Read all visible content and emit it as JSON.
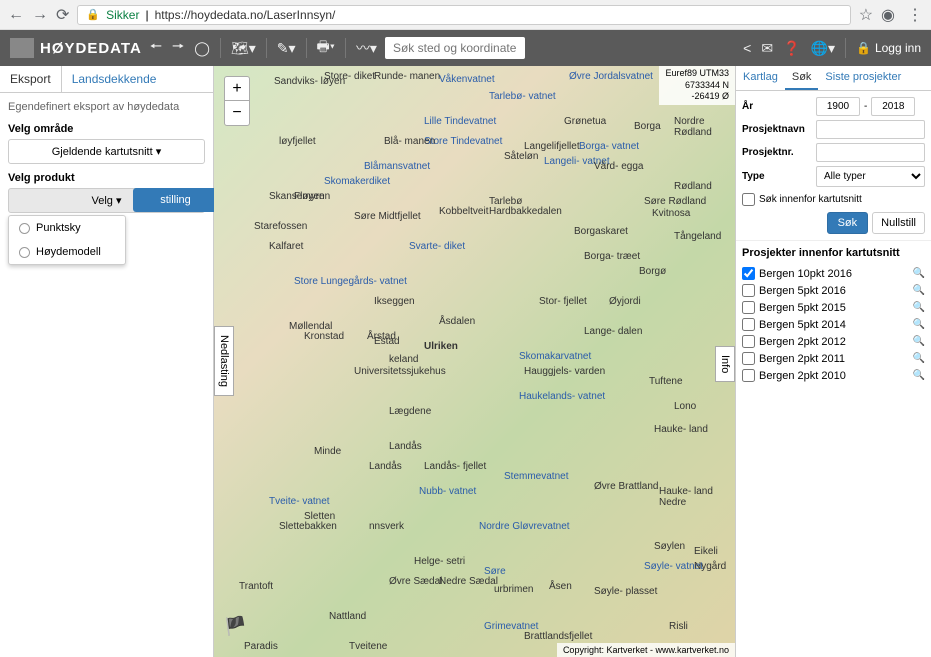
{
  "browser": {
    "secure_label": "Sikker",
    "url": "https://hoydedata.no/LaserInnsyn/"
  },
  "header": {
    "brand": "HØYDEDATA",
    "search_placeholder": "Søk sted og koordinater",
    "login": "Logg inn"
  },
  "left": {
    "tabs": {
      "eksport": "Eksport",
      "lands": "Landsdekkende"
    },
    "desc": "Egendefinert eksport av høydedata",
    "velg_omrade": "Velg område",
    "gjeldende": "Gjeldende kartutsnitt",
    "velg_produkt": "Velg produkt",
    "velg": "Velg",
    "punktsky": "Punktsky",
    "hoydemodell": "Høydemodell",
    "bestilling": "stilling"
  },
  "map": {
    "zoom_in": "+",
    "zoom_out": "−",
    "nedlasting": "Nedlasting",
    "info": "Info",
    "coord_sys": "Euref89 UTM33",
    "coord_n": "6733344 N",
    "coord_e": "-26419 Ø",
    "credit": "Copyright: Kartverket - www.kartverket.no",
    "labels": {
      "loyfjellet": "løyfjellet",
      "ulriken": "Ulriken",
      "storfjellet": "Stor-\nfjellet",
      "vardegga": "Vård-\negga",
      "borga": "Borga",
      "nordre_rodland": "Nordre\nRødland",
      "rodland": "Rødland",
      "tangeland": "Tångeland",
      "borgo": "Borgø",
      "langedalen": "Lange-\ndalen",
      "lono": "Lono",
      "haukeland": "Hauke-\nland",
      "ovre_brattland": "Øvre\nBrattland",
      "haukeland_nedre": "Hauke-\nland\nNedre",
      "eikeli": "Eikeli",
      "soylen": "Søylen",
      "nattland": "Nattland",
      "paradis": "Paradis",
      "minde": "Minde",
      "kronstad": "Kronstad",
      "landas": "Landås",
      "gronetua": "Grønetua",
      "sandviksloyen": "Sandviks-\nløyen",
      "rundemanen": "Runde-\nmanen",
      "blamanen": "Blå-\nmanen",
      "sore_midtfjellet": "Søre\nMidtfjellet",
      "svartediket": "Svarte-\ndiket",
      "universitetssjukehus": "Universitetssjukehus",
      "haugjelsvarden": "Hauggjels-\nvarden",
      "skomakarvatnet": "Skomakarvatnet",
      "haukelandsvatnet": "Haukelands-\nvatnet",
      "landasfjellet": "Landås-\nfjellet",
      "stemmevatnet": "Stemmevatnet",
      "nordre_glovrevatnet": "Nordre\nGløvrevatnet",
      "grimevatnet": "Grimevatnet",
      "nedre_saedal": "Nedre\nSædal",
      "ovre_saedal": "Øvre\nSædal",
      "brattlandsfjellet": "Brattlandsfjellet",
      "risli": "Risli",
      "soylevatnet": "Søyle-\nvatnet",
      "soyleplasset": "Søyle-\nplasset",
      "asen": "Åsen",
      "asdalen": "Åsdalen",
      "laegdene": "Lægdene",
      "tarlebo": "Tarlebø",
      "tarlebovatnet": "Tarlebø-\nvatnet",
      "blamansvatnet": "Blåmansvatnet",
      "vakenvatnet": "Våkenvatnet",
      "lille_tindevatnet": "Lille\nTindevatnet",
      "store_tindevatnet": "Store\nTindevatnet",
      "langelifjellet": "Langelifjellet",
      "borgavatnet": "Borga-\nvatnet",
      "langelivatnet": "Langeli-\nvatnet",
      "sore_rodland": "Søre Rødland",
      "kvitnosa": "Kvitnosa",
      "skomakerdiket": "Skomakerdiket",
      "storediket": "Store-\ndiket",
      "store_lungegards": "Store\nLungegårds-\nvatnet",
      "mollendal": "Møllendal",
      "arstad": "Årstad",
      "fikseggen": "Ikseggen",
      "starefossen": "Starefossen",
      "skansemyren": "Skansemyren",
      "floyen": "Fløyen",
      "kalfaret": "Kalfaret",
      "hardbakkedalen": "Hardbakkedalen",
      "kobbeltveit": "Kobbeltveit",
      "sateelen": "Såteløn",
      "borgaskaret": "Borgaskaret",
      "mannsverk": "nnsverk",
      "slettebakken": "Slettebakken",
      "sletten": "Sletten",
      "tveitebotn": "Tveite-\nvatnet",
      "landas2": "Landås",
      "frantoft": "Trantoft",
      "nubbvatnet": "Nubb-\nvatnet",
      "helgesetri": "Helge-\nsetri",
      "sore2": "Søre",
      "ovre_jordalsvatnet": "Øvre\nJordalsvatnet",
      "borgatraeet": "Borga-\ntræet",
      "oyjordi": "Øyjordi",
      "tuftene": "Tuftene",
      "estad": "Estad",
      "keland": "keland",
      "murbrimen": "urbrimen",
      "tveitene": "Tveitene",
      "nyegard": "Nygård"
    }
  },
  "right": {
    "tabs": {
      "kartlag": "Kartlag",
      "sok": "Søk",
      "siste": "Siste prosjekter"
    },
    "ar": "År",
    "ar_from": "1900",
    "ar_to": "2018",
    "prosjektnavn": "Prosjektnavn",
    "prosjektnr": "Prosjektnr.",
    "type": "Type",
    "type_value": "Alle typer",
    "sok_innenfor": "Søk innenfor kartutsnitt",
    "sok_btn": "Søk",
    "nullstill": "Nullstill",
    "projects_title": "Prosjekter innenfor kartutsnitt",
    "projects": [
      {
        "name": "Bergen 10pkt 2016",
        "checked": true
      },
      {
        "name": "Bergen 5pkt 2016",
        "checked": false
      },
      {
        "name": "Bergen 5pkt 2015",
        "checked": false
      },
      {
        "name": "Bergen 5pkt 2014",
        "checked": false
      },
      {
        "name": "Bergen 2pkt 2012",
        "checked": false
      },
      {
        "name": "Bergen 2pkt 2011",
        "checked": false
      },
      {
        "name": "Bergen 2pkt 2010",
        "checked": false
      }
    ]
  }
}
